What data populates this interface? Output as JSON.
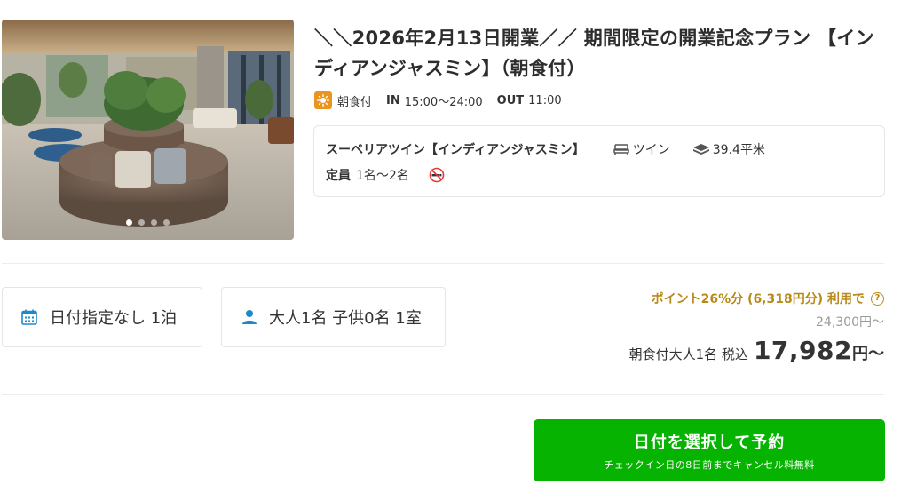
{
  "gallery": {
    "image_alt": "lobby photo",
    "slides": 4,
    "active_slide": 1
  },
  "plan": {
    "title": "＼＼2026年2月13日開業／／ 期間限定の開業記念プラン 【インディアンジャスミン】（朝食付）",
    "meal_label": "朝食付",
    "checkin_label": "IN",
    "checkin_time": "15:00〜24:00",
    "checkout_label": "OUT",
    "checkout_time": "11:00"
  },
  "room": {
    "name": "スーペリアツイン【インディアンジャスミン】",
    "bed_type": "ツイン",
    "size": "39.4平米",
    "capacity_label": "定員",
    "capacity_value": "1名〜2名",
    "non_smoking": true
  },
  "selectors": {
    "date": "日付指定なし 1泊",
    "guests": "大人1名 子供0名 1室"
  },
  "price": {
    "points_text": "ポイント26%分 (6,318円分) 利用で",
    "original": "24,300円〜",
    "prefix": "朝食付大人1名 税込",
    "amount": "17,982",
    "suffix": "円〜"
  },
  "cta": {
    "main": "日付を選択して予約",
    "sub": "チェックイン日の8日前までキャンセル料無料"
  },
  "colors": {
    "accent_green": "#06b300",
    "points_gold": "#b88a1a",
    "meal_orange": "#e9951f",
    "icon_blue": "#1e88c8"
  }
}
